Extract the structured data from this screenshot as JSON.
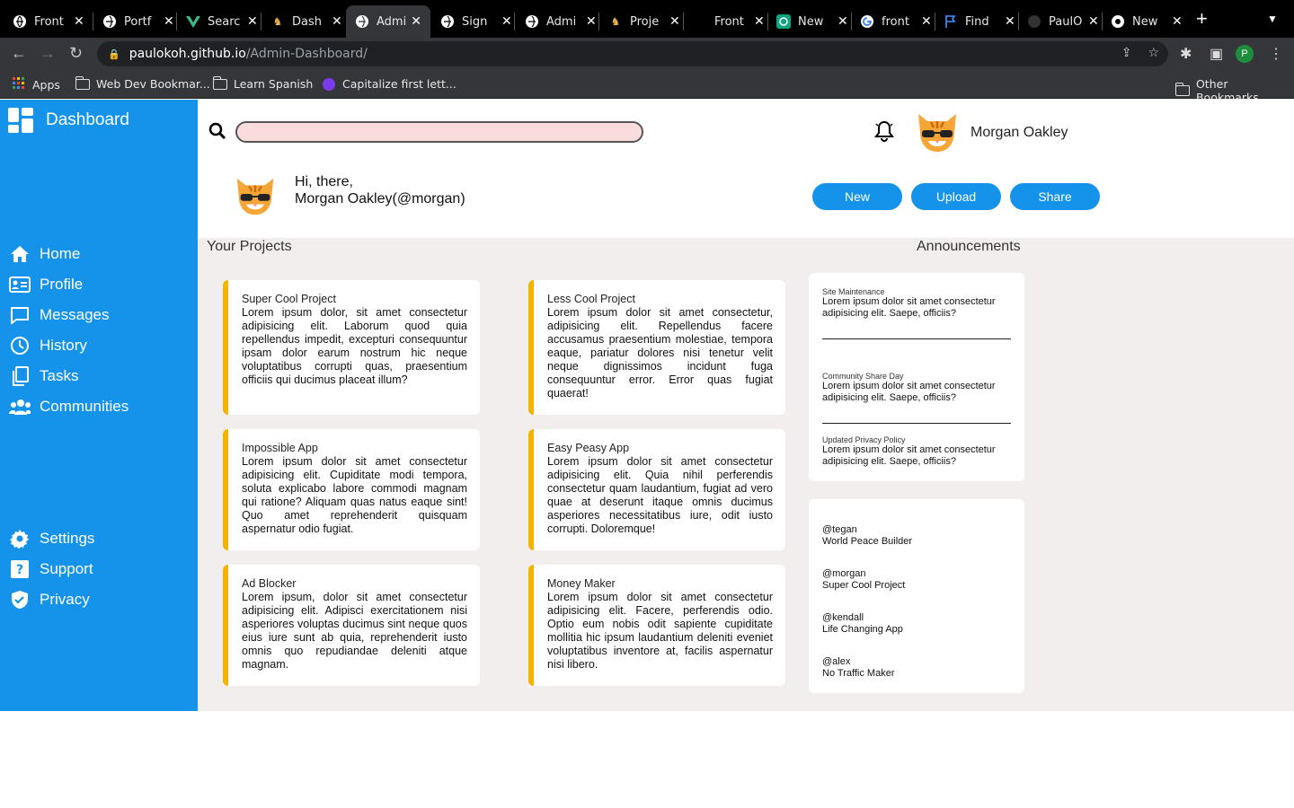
{
  "browser": {
    "tabs": [
      {
        "label": "Front"
      },
      {
        "label": "Portf"
      },
      {
        "label": "Searc"
      },
      {
        "label": "Dash"
      },
      {
        "label": "Admi"
      },
      {
        "label": "Sign"
      },
      {
        "label": "Admi"
      },
      {
        "label": "Proje"
      },
      {
        "label": "Front"
      },
      {
        "label": "New"
      },
      {
        "label": "front"
      },
      {
        "label": "Find"
      },
      {
        "label": "PaulO"
      },
      {
        "label": "New"
      }
    ],
    "url_host": "paulokoh.github.io",
    "url_path": "/Admin-Dashboard/",
    "profile_initial": "P",
    "bookmarks": {
      "apps": "Apps",
      "items": [
        "Web Dev Bookmar...",
        "Learn Spanish",
        "Capitalize first lett..."
      ],
      "other": "Other Bookmarks"
    }
  },
  "sidebar": {
    "title": "Dashboard",
    "nav": [
      "Home",
      "Profile",
      "Messages",
      "History",
      "Tasks",
      "Communities"
    ],
    "bottom_nav": [
      "Settings",
      "Support",
      "Privacy"
    ]
  },
  "header": {
    "username": "Morgan Oakley",
    "greeting": "Hi, there,",
    "handle": "Morgan Oakley(@morgan)",
    "buttons": {
      "new": "New",
      "upload": "Upload",
      "share": "Share"
    }
  },
  "projects": {
    "title": "Your Projects",
    "cards": [
      {
        "title": "Super Cool Project",
        "text": "Lorem ipsum dolor, sit amet consectetur adipisicing elit. Laborum quod quia repellendus impedit, excepturi consequuntur ipsam dolor earum nostrum hic neque voluptatibus corrupti quas, praesentium officiis qui ducimus placeat illum?"
      },
      {
        "title": "Less Cool Project",
        "text": "Lorem ipsum dolor sit amet consectetur, adipisicing elit. Repellendus facere accusamus praesentium molestiae, tempora eaque, pariatur dolores nisi tenetur velit neque dignissimos incidunt fuga consequuntur error. Error quas fugiat quaerat!"
      },
      {
        "title": "Impossible App",
        "text": "Lorem ipsum dolor sit amet consectetur adipisicing elit. Cupiditate modi tempora, soluta explicabo labore commodi magnam qui ratione? Aliquam quas natus eaque sint! Quo amet reprehenderit quisquam aspernatur odio fugiat."
      },
      {
        "title": "Easy Peasy App",
        "text": "Lorem ipsum dolor sit amet consectetur adipisicing elit. Quia nihil perferendis consectetur quam laudantium, fugiat ad vero quae at deserunt itaque omnis ducimus asperiores necessitatibus iure, odit iusto corrupti. Doloremque!"
      },
      {
        "title": "Ad Blocker",
        "text": "Lorem ipsum, dolor sit amet consectetur adipisicing elit. Adipisci exercitationem nisi asperiores voluptas ducimus sint neque quos eius iure sunt ab quia, reprehenderit iusto omnis quo repudiandae deleniti atque magnam."
      },
      {
        "title": "Money Maker",
        "text": "Lorem ipsum dolor sit amet consectetur adipisicing elit. Facere, perferendis odio. Optio eum nobis odit sapiente cupiditate mollitia hic ipsum laudantium deleniti eveniet voluptatibus inventore at, facilis aspernatur nisi libero."
      }
    ]
  },
  "announcements": {
    "title": "Announcements",
    "items": [
      {
        "title": "Site Maintenance",
        "text": "Lorem ipsum dolor sit amet consectetur adipisicing elit. Saepe, officiis?"
      },
      {
        "title": "Community Share Day",
        "text": "Lorem ipsum dolor sit amet consectetur adipisicing elit. Saepe, officiis?"
      },
      {
        "title": "Updated Privacy Policy",
        "text": "Lorem ipsum dolor sit amet consectetur adipisicing elit. Saepe, officiis?"
      }
    ]
  },
  "trending": [
    {
      "handle": "@tegan",
      "project": "World Peace Builder"
    },
    {
      "handle": "@morgan",
      "project": "Super Cool Project"
    },
    {
      "handle": "@kendall",
      "project": "Life Changing App"
    },
    {
      "handle": "@alex",
      "project": "No Traffic Maker"
    }
  ]
}
